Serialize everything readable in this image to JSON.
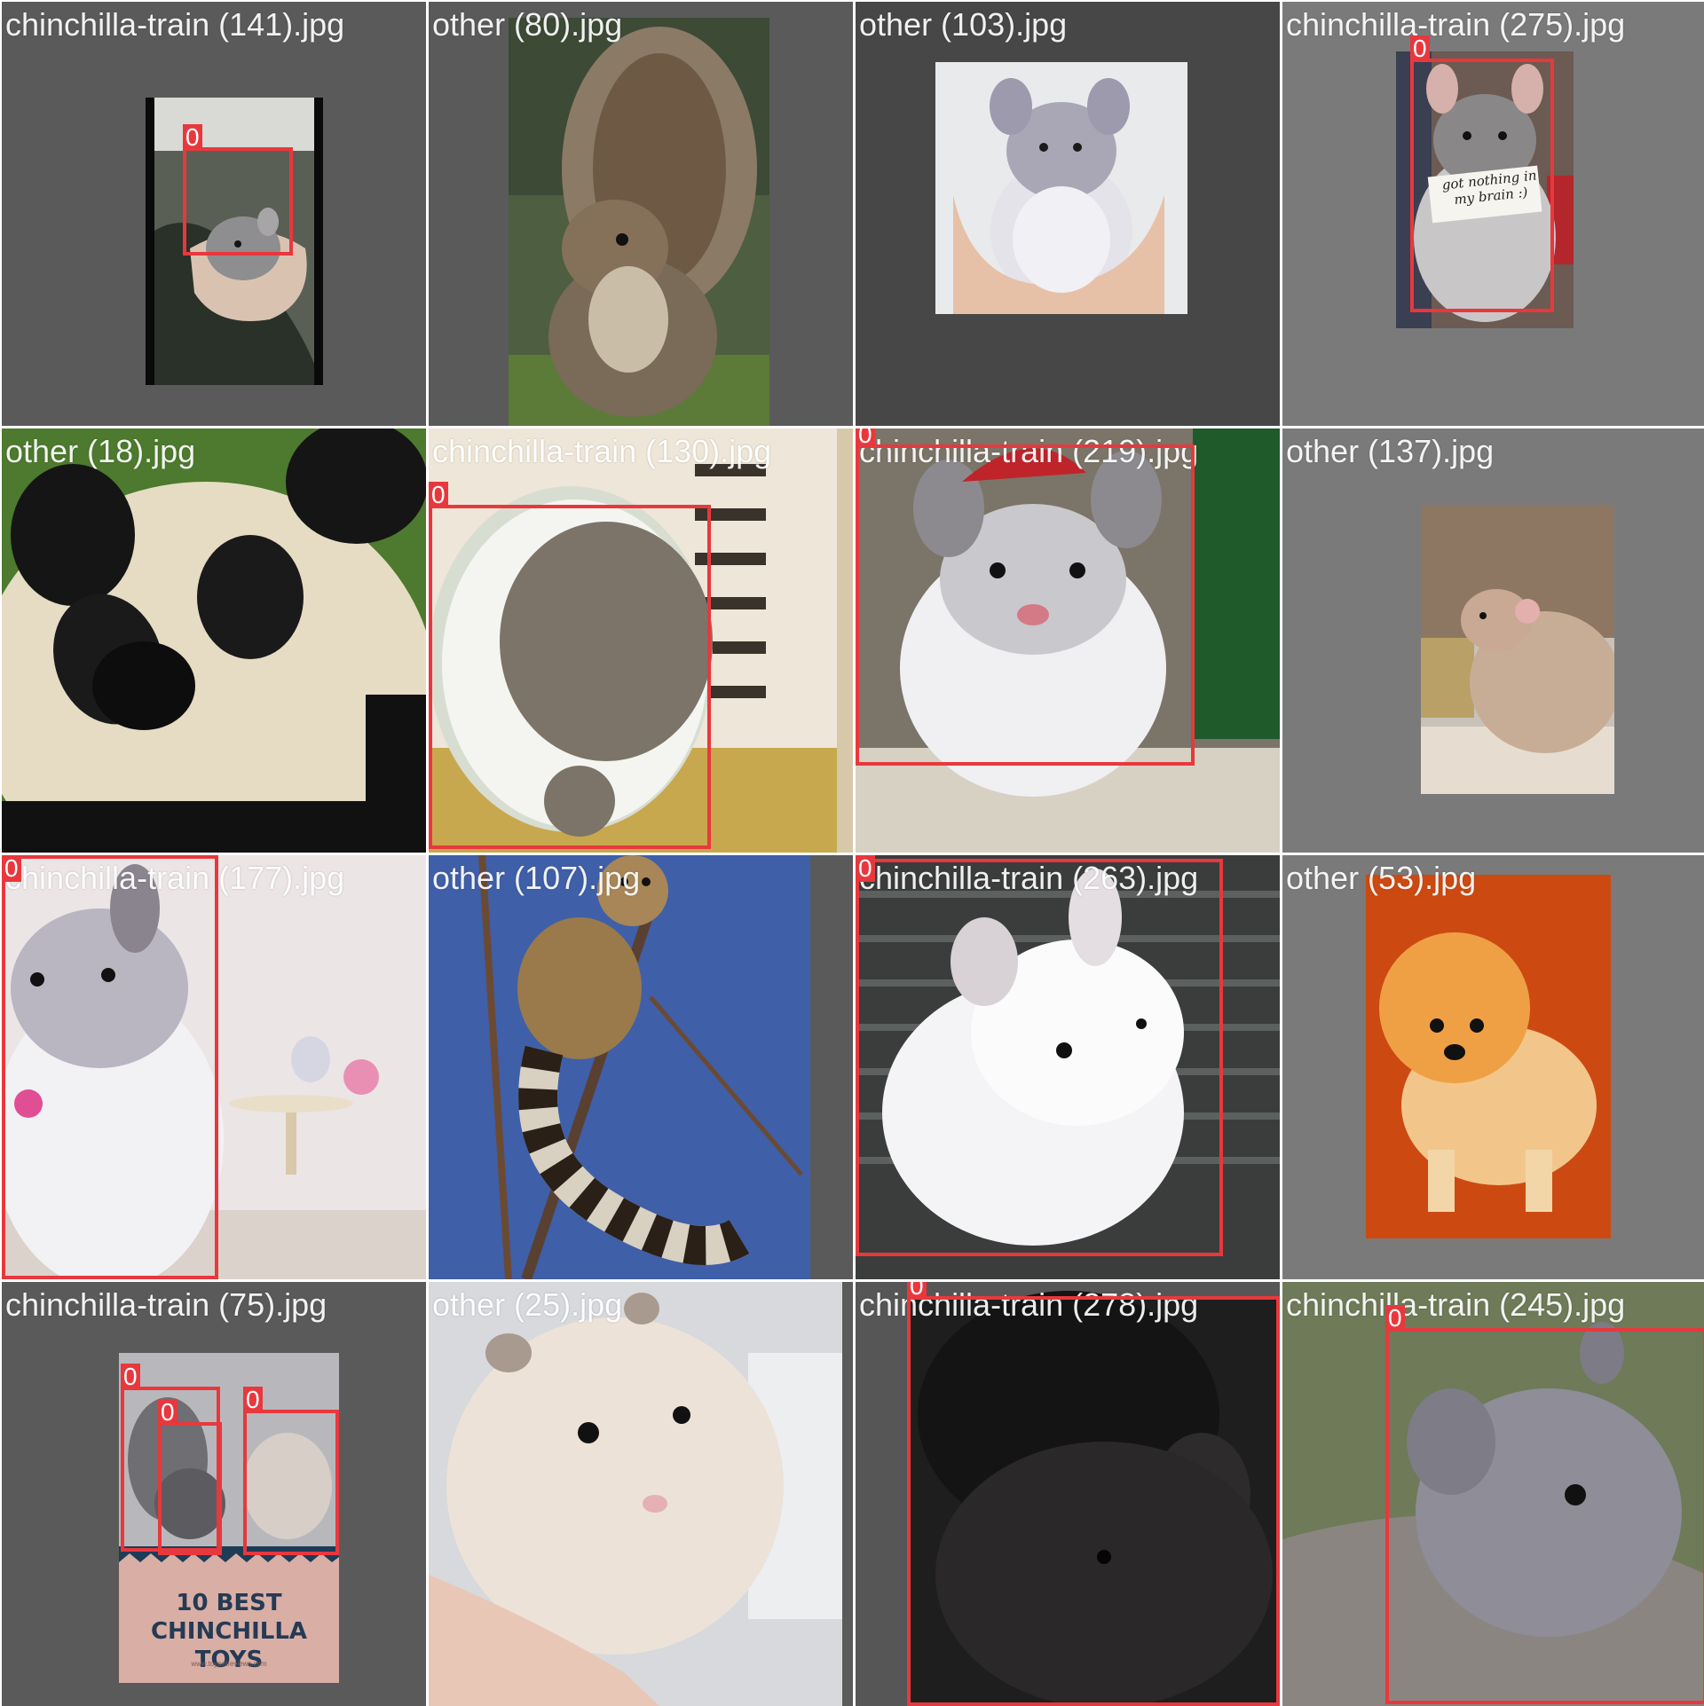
{
  "grid": {
    "tiles": [
      {
        "filename": "chinchilla-train (141).jpg",
        "bg": "#5a5a5a",
        "subject": "chinchilla held in hand",
        "label": "0"
      },
      {
        "filename": "other (80).jpg",
        "bg": "#5a5a5a",
        "subject": "squirrel"
      },
      {
        "filename": "other (103).jpg",
        "bg": "#474747",
        "subject": "plush chinchilla in hands"
      },
      {
        "filename": "chinchilla-train (275).jpg",
        "bg": "#7a7a7a",
        "subject": "chinchilla with note",
        "label": "0",
        "note_line1": "got nothing in",
        "note_line2": "my brain :)"
      },
      {
        "filename": "other (18).jpg",
        "bg": "#5a5a5a",
        "subject": "panda"
      },
      {
        "filename": "chinchilla-train (130).jpg",
        "bg": "#5a5a5a",
        "subject": "chinchilla in glass bowl",
        "label": "0"
      },
      {
        "filename": "chinchilla-train (219).jpg",
        "bg": "#5a5a5a",
        "subject": "chinchilla with santa hat",
        "label": "0"
      },
      {
        "filename": "other (137).jpg",
        "bg": "#7a7a7a",
        "subject": "rat"
      },
      {
        "filename": "chinchilla-train (177).jpg",
        "bg": "#5a5a5a",
        "subject": "white chinchilla",
        "label": "0"
      },
      {
        "filename": "other (107).jpg",
        "bg": "#5a5a5a",
        "subject": "ringtail in tree"
      },
      {
        "filename": "chinchilla-train (263).jpg",
        "bg": "#5a5a5a",
        "subject": "white chinchilla in cage",
        "label": "0"
      },
      {
        "filename": "other (53).jpg",
        "bg": "#7a7a7a",
        "subject": "pomeranian dog"
      },
      {
        "filename": "chinchilla-train (75).jpg",
        "bg": "#5a5a5a",
        "subject": "chinchilla toys poster",
        "label": "0",
        "poster_title_1": "10 BEST",
        "poster_title_2": "CHINCHILLA TOYS",
        "poster_url": "www.toypetreviews.com"
      },
      {
        "filename": "other (25).jpg",
        "bg": "#5a5a5a",
        "subject": "hamster in hand"
      },
      {
        "filename": "chinchilla-train (278).jpg",
        "bg": "#5a5a5a",
        "subject": "dark chinchilla",
        "label": "0"
      },
      {
        "filename": "chinchilla-train (245).jpg",
        "bg": "#7a7a7a",
        "subject": "grey chinchilla on rock",
        "label": "0"
      }
    ]
  },
  "colors": {
    "box": "#e8383d",
    "label_text": "#ffffff"
  }
}
